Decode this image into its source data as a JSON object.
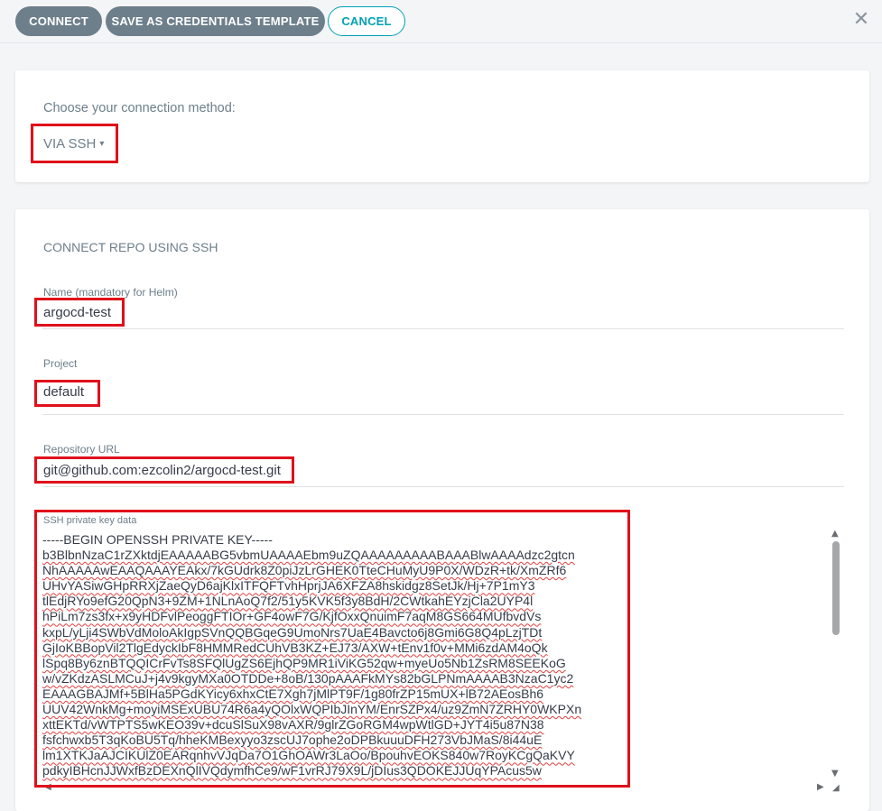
{
  "toolbar": {
    "connect_label": "CONNECT",
    "save_template_label": "SAVE AS CREDENTIALS TEMPLATE",
    "cancel_label": "CANCEL",
    "close_glyph": "✕"
  },
  "method": {
    "prompt": "Choose your connection method:",
    "selected": "VIA SSH",
    "caret_glyph": "▾"
  },
  "form": {
    "heading": "CONNECT REPO USING SSH",
    "name": {
      "label": "Name (mandatory for Helm)",
      "value": "argocd-test"
    },
    "project": {
      "label": "Project",
      "value": "default"
    },
    "repo_url": {
      "label": "Repository URL",
      "value": "git@github.com:ezcolin2/argocd-test.git"
    },
    "ssh_key": {
      "label": "SSH private key data",
      "lines": [
        "-----BEGIN OPENSSH PRIVATE KEY-----",
        "b3BlbnNzaC1rZXktdjEAAAAABG5vbmUAAAAEbm9uZQAAAAAAAAABAAABlwAAAAdzc2gtcn",
        "NhAAAAAwEAAQAAAYEAkx/7kGUdrk8Z0piJzLrGHEK0TteCHuMyU9P0X/WDzR+tk/XmZRf6",
        "UHvYASiwGHpRRXjZaeQyD6ajKlxITFQFTvhHprjJA6XFZA8hskidgz8SetJk/Hj+7P1mY3",
        "tlEdjRYo9efG20QpN3+9ZM+1NLnAoQ7f2/51y5KVK5f3y8BdH/2CWtkahEYzjCla2UYP4l",
        "hPiLm7zs3fx+x9yHDFvlPeoggFTIOr+GF4owF7G/KjfOxxQnuimF7aqM8GS664MUfbvdVs",
        "kxpL/yLji4SWbVdMoloAkIgpSVnQQBGqeG9UmoNrs7UaE4Bavcto6j8Gmi6G8Q4pLzjTDt",
        "GjIoKBBopVil2TlgEdyckIbF8HMMRedCUhVB3KZ+EJ73/AXW+tEnv1f0v+MMi6zdAM4oQk",
        "lSpq8By6znBTQQICrFvTs8SFQlUgZS6EjhQP9MR1iViKG52qw+myeUo5Nb1ZsRM8SEEKoG",
        "w/vZKdzASLMCuJ+j4v9kgyMXa0OTDDe+8oB/130pAAAFkMYs82bGLPNmAAAAB3NzaC1yc2",
        "EAAAGBAJMf+5BlHa5PGdKYicy6xhxCtE7Xgh7jMlPT9F/1g80frZP15mUX+lB72AEosBh6",
        "UUV42WnkMg+moyiMSExUBU74R6a4yQOlxWQPIbJInYM/EnrSZPx4/uz9ZmN7ZRHY0WKPXn",
        "xttEKTd/vWTPTS5wKEO39v+dcuSlSuX98vAXR/9glrZGoRGM4wpWtlGD+JYT4i5u87N38",
        "fsfchwxb5T3qKoBU5Tq/hheKMBexyyo3zscUJ7ophe2oDPBkuuuDFH273VbJMaS/8i44uE",
        "lm1XTKJaAJCIKUlZ0EARqnhvVJqDa7O1GhOAWr3LaOo/BpouhvEOKS840w7RoyKCgQaKVY",
        "pdkyIBHcnJJWxfBzDEXnQlIVQdymfhCe9/wF1vrRJ79X9L/jDIus3QDOKEJJUqYPAcus5w"
      ]
    }
  }
}
